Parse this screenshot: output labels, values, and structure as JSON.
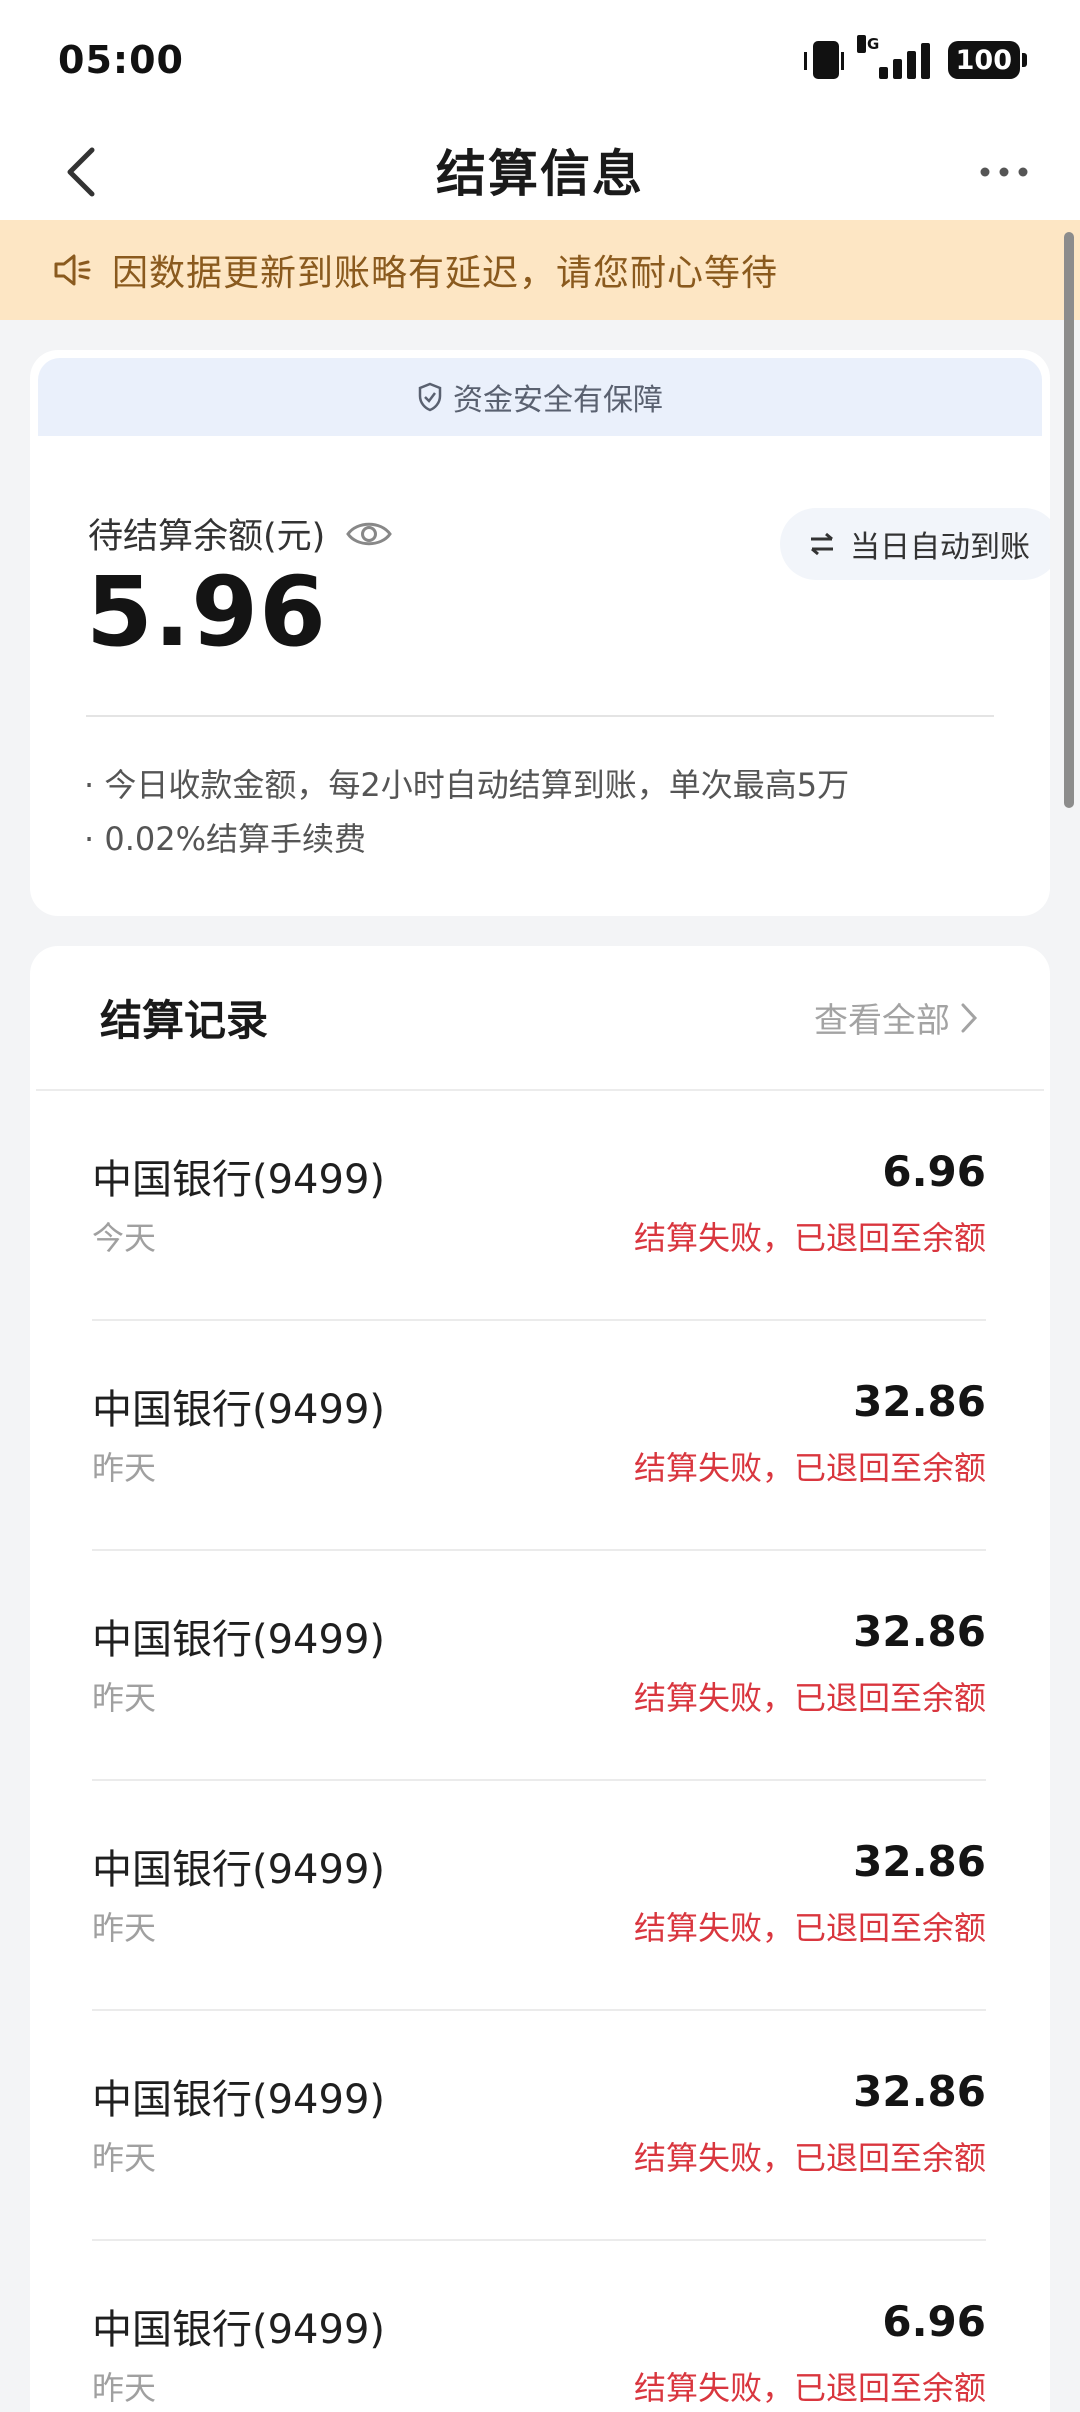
{
  "status_bar": {
    "time": "05:00",
    "network": "5G",
    "battery": "100"
  },
  "nav": {
    "title": "结算信息"
  },
  "notice": {
    "text": "因数据更新到账略有延迟，请您耐心等待"
  },
  "balance": {
    "safe_text": "资金安全有保障",
    "label": "待结算余额(元)",
    "amount": "5.96",
    "auto_label": "当日自动到账",
    "tips": [
      "· 今日收款金额，每2小时自动结算到账，单次最高5万",
      "· 0.02%结算手续费"
    ]
  },
  "records": {
    "title": "结算记录",
    "view_all": "查看全部",
    "items": [
      {
        "bank": "中国银行(9499)",
        "date": "今天",
        "amount": "6.96",
        "status": "结算失败，已退回至余额"
      },
      {
        "bank": "中国银行(9499)",
        "date": "昨天",
        "amount": "32.86",
        "status": "结算失败，已退回至余额"
      },
      {
        "bank": "中国银行(9499)",
        "date": "昨天",
        "amount": "32.86",
        "status": "结算失败，已退回至余额"
      },
      {
        "bank": "中国银行(9499)",
        "date": "昨天",
        "amount": "32.86",
        "status": "结算失败，已退回至余额"
      },
      {
        "bank": "中国银行(9499)",
        "date": "昨天",
        "amount": "32.86",
        "status": "结算失败，已退回至余额"
      },
      {
        "bank": "中国银行(9499)",
        "date": "昨天",
        "amount": "6.96",
        "status": "结算失败，已退回至余额"
      }
    ]
  },
  "colors": {
    "accent_red": "#d9363e",
    "notice_bg": "#fde6c4",
    "notice_text": "#8a5a1e"
  },
  "icons": {
    "back": "chevron-left-icon",
    "more": "more-dots-icon",
    "notice": "speaker-icon",
    "safe": "shield-icon",
    "eye": "eye-icon",
    "auto": "transfer-arrows-icon",
    "view_all": "chevron-right-icon"
  }
}
